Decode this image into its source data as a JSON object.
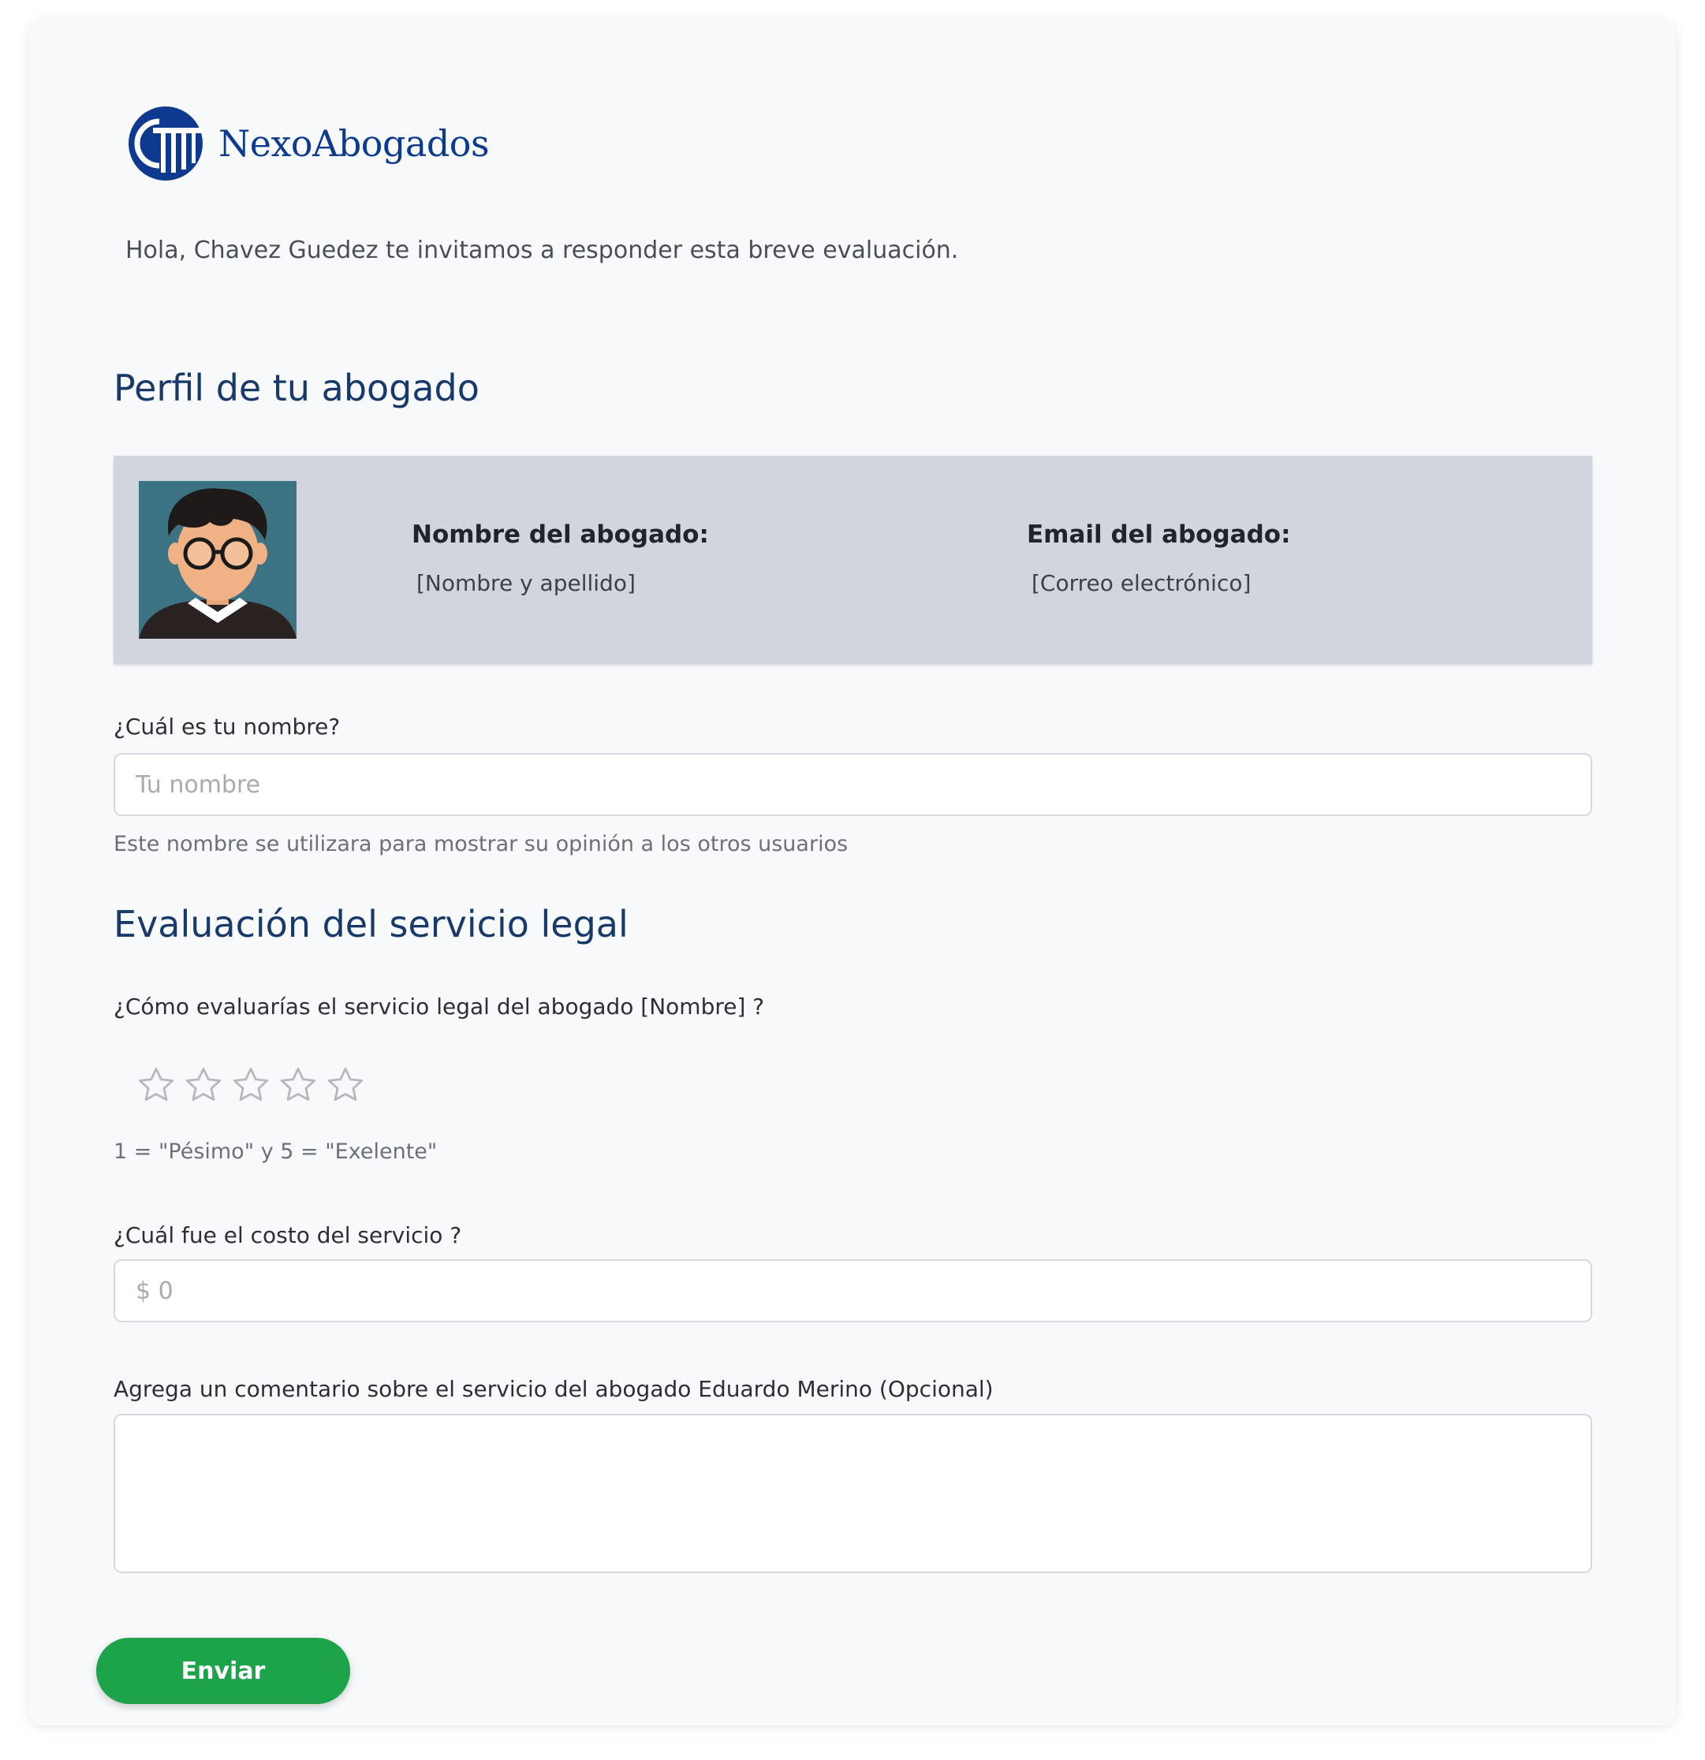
{
  "brand": {
    "name": "NexoAbogados",
    "color": "#0d3a8f"
  },
  "greeting": "Hola, Chavez Guedez te invitamos a responder esta breve evaluación.",
  "profile_section": {
    "title": "Perfil de tu abogado",
    "name_label": "Nombre del abogado:",
    "name_value": "[Nombre y apellido]",
    "email_label": "Email del abogado:",
    "email_value": "[Correo electrónico]"
  },
  "name_question": {
    "label": "¿Cuál es tu nombre?",
    "placeholder": "Tu nombre",
    "help": "Este nombre se utilizara para mostrar su opinión a los otros usuarios"
  },
  "evaluation_section": {
    "title": "Evaluación del servicio legal",
    "rating_question": "¿Cómo evaluarías el servicio legal del abogado [Nombre] ?",
    "rating_stars_total": 5,
    "rating_value": 0,
    "rating_scale": "1 = \"Pésimo\" y 5 = \"Exelente\"",
    "cost_question": "¿Cuál fue el costo del servicio ?",
    "cost_placeholder": "$ 0",
    "comment_question": "Agrega un comentario sobre el servicio del abogado Eduardo Merino (Opcional)"
  },
  "submit_label": "Enviar",
  "colors": {
    "heading": "#173a6b",
    "submit": "#1da34a",
    "profile_bg": "#d2d5dd"
  }
}
